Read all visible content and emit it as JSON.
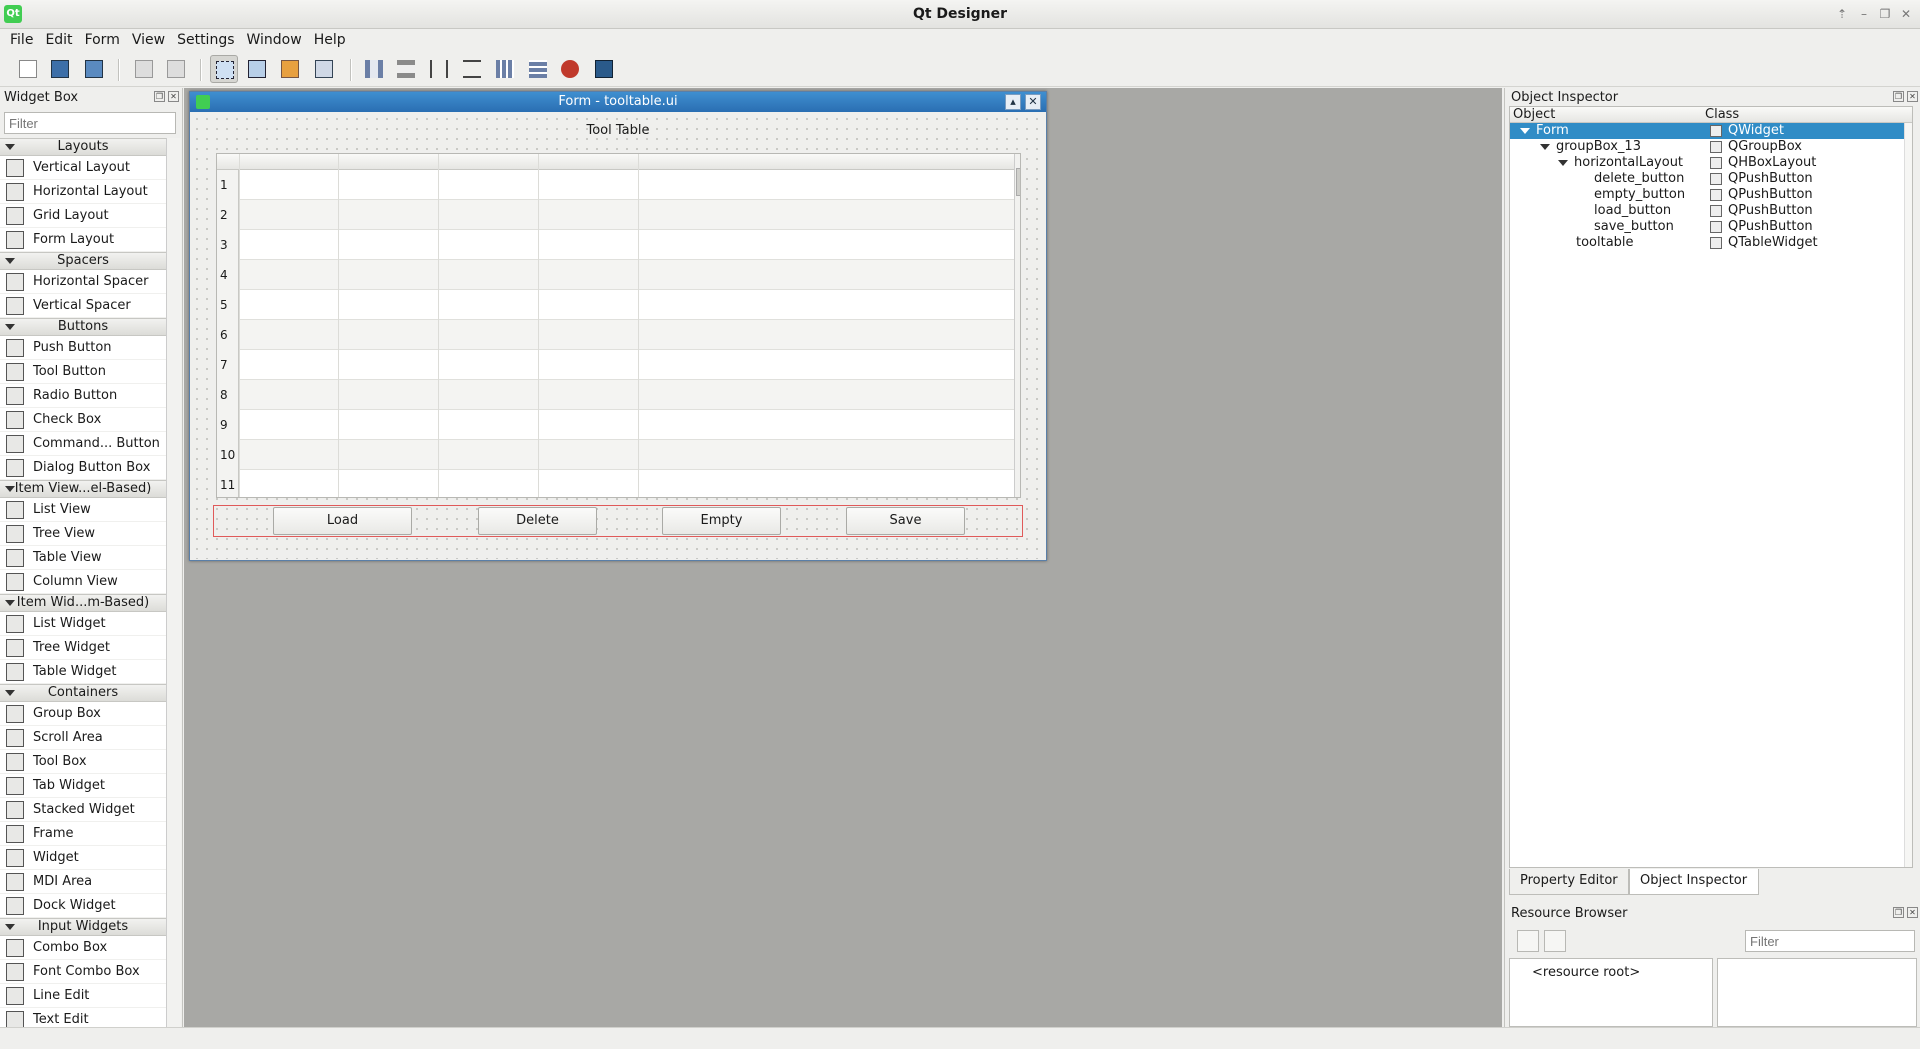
{
  "window": {
    "title": "Qt Designer",
    "logo": "Qt"
  },
  "menu": [
    "File",
    "Edit",
    "Form",
    "View",
    "Settings",
    "Window",
    "Help"
  ],
  "widget_box": {
    "title": "Widget Box",
    "filter_placeholder": "Filter",
    "categories": [
      {
        "name": "Layouts",
        "items": [
          "Vertical Layout",
          "Horizontal Layout",
          "Grid Layout",
          "Form Layout"
        ]
      },
      {
        "name": "Spacers",
        "items": [
          "Horizontal Spacer",
          "Vertical Spacer"
        ]
      },
      {
        "name": "Buttons",
        "items": [
          "Push Button",
          "Tool Button",
          "Radio Button",
          "Check Box",
          "Command... Button",
          "Dialog Button Box"
        ]
      },
      {
        "name": "Item View...el-Based)",
        "items": [
          "List View",
          "Tree View",
          "Table View",
          "Column View"
        ]
      },
      {
        "name": "Item Wid...m-Based)",
        "items": [
          "List Widget",
          "Tree Widget",
          "Table Widget"
        ]
      },
      {
        "name": "Containers",
        "items": [
          "Group Box",
          "Scroll Area",
          "Tool Box",
          "Tab Widget",
          "Stacked Widget",
          "Frame",
          "Widget",
          "MDI Area",
          "Dock Widget"
        ]
      },
      {
        "name": "Input Widgets",
        "items": [
          "Combo Box",
          "Font Combo Box",
          "Line Edit",
          "Text Edit"
        ]
      }
    ]
  },
  "form": {
    "title": "Form - tooltable.ui",
    "groupbox_title": "Tool Table",
    "row_numbers": [
      "1",
      "2",
      "3",
      "4",
      "5",
      "6",
      "7",
      "8",
      "9",
      "10",
      "11"
    ],
    "buttons": {
      "load": "Load",
      "delete": "Delete",
      "empty": "Empty",
      "save": "Save"
    }
  },
  "object_inspector": {
    "title": "Object Inspector",
    "col_object": "Object",
    "col_class": "Class",
    "rows": [
      {
        "object": "Form",
        "class": "QWidget"
      },
      {
        "object": "groupBox_13",
        "class": "QGroupBox"
      },
      {
        "object": "horizontalLayout",
        "class": "QHBoxLayout"
      },
      {
        "object": "delete_button",
        "class": "QPushButton"
      },
      {
        "object": "empty_button",
        "class": "QPushButton"
      },
      {
        "object": "load_button",
        "class": "QPushButton"
      },
      {
        "object": "save_button",
        "class": "QPushButton"
      },
      {
        "object": "tooltable",
        "class": "QTableWidget"
      }
    ]
  },
  "dock_tabs": [
    "Property Editor",
    "Object Inspector"
  ],
  "resource_browser": {
    "title": "Resource Browser",
    "filter_placeholder": "Filter",
    "root": "<resource root>"
  },
  "colors": {
    "selection": "#308cc6",
    "form_title": "#2a6eb2",
    "buttonbox_border": "#e05a5a"
  }
}
